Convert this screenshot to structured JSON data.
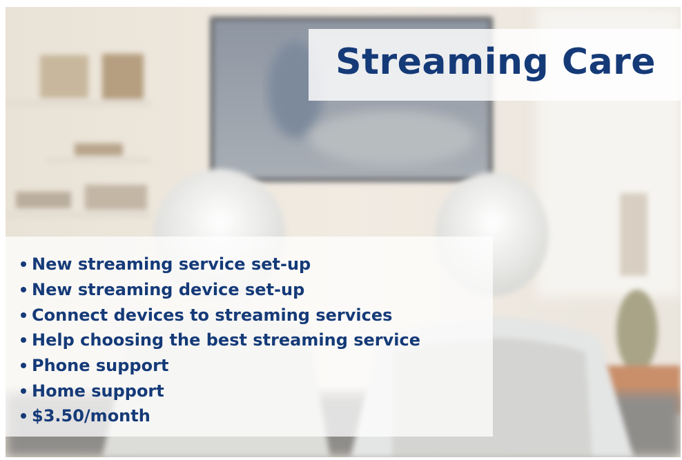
{
  "title": "Streaming Care",
  "features": [
    "New streaming service set-up",
    "New streaming device set-up",
    "Connect devices to streaming services",
    "Help choosing the best streaming service",
    "Phone support",
    "Home support",
    "$3.50/month"
  ],
  "colors": {
    "brand_navy": "#153a78",
    "panel_white": "#ffffff"
  }
}
